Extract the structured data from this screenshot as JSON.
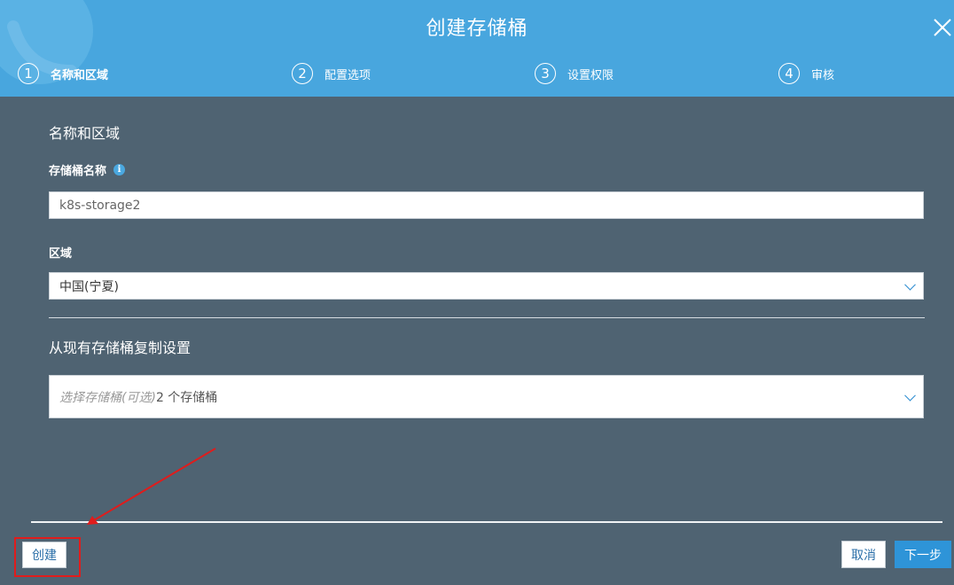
{
  "header": {
    "title": "创建存储桶",
    "steps": [
      {
        "num": "1",
        "label": "名称和区域"
      },
      {
        "num": "2",
        "label": "配置选项"
      },
      {
        "num": "3",
        "label": "设置权限"
      },
      {
        "num": "4",
        "label": "审核"
      }
    ]
  },
  "form": {
    "section_title": "名称和区域",
    "bucket_name_label": "存储桶名称",
    "bucket_name_value": "k8s-storage2",
    "region_label": "区域",
    "region_value": "中国(宁夏)",
    "copy_section_title": "从现有存储桶复制设置",
    "copy_placeholder": "选择存储桶(可选)",
    "copy_count": "2 个存储桶"
  },
  "footer": {
    "create_label": "创建",
    "cancel_label": "取消",
    "next_label": "下一步"
  },
  "colors": {
    "header_bg": "#48a6de",
    "body_bg": "#4f6372",
    "primary": "#2e94d8",
    "annotation": "#e01c1c"
  }
}
